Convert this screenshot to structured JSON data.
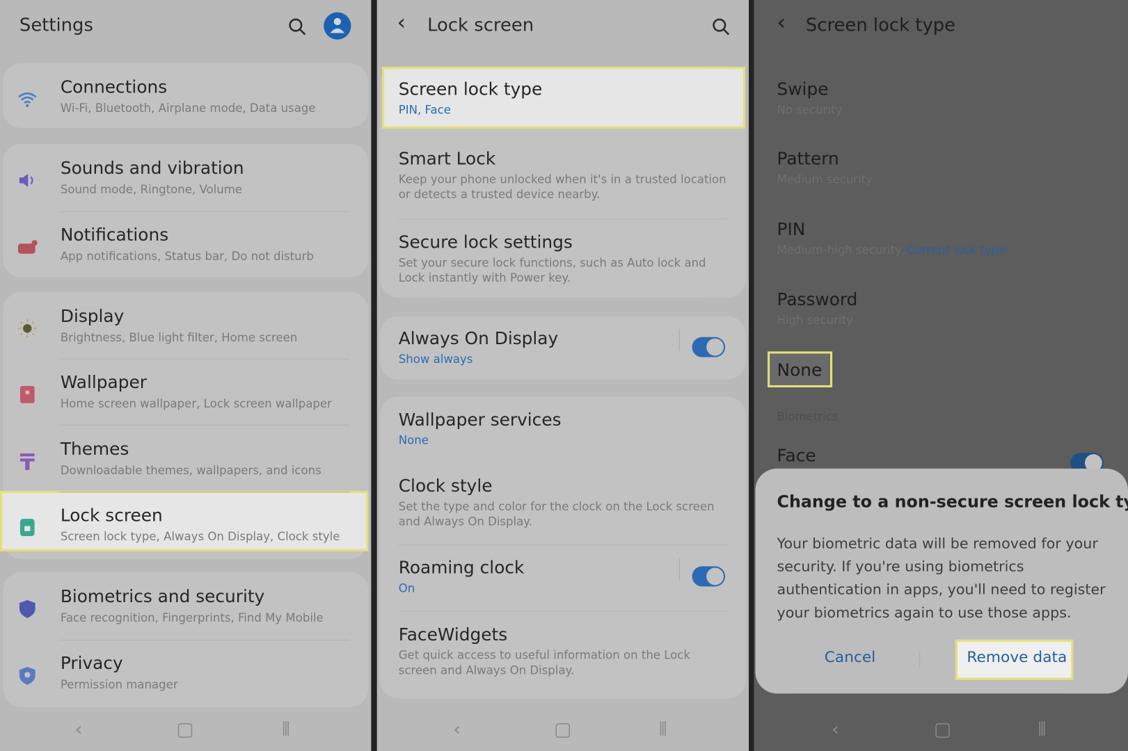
{
  "colors": {
    "accent": "#2c6bb3",
    "highlight": "#e3e07a"
  },
  "settings": {
    "title": "Settings",
    "items": [
      {
        "title": "Connections",
        "subtitle": "Wi-Fi, Bluetooth, Airplane mode, Data usage",
        "icon": "wifi-icon"
      },
      {
        "title": "Sounds and vibration",
        "subtitle": "Sound mode, Ringtone, Volume",
        "icon": "speaker-icon"
      },
      {
        "title": "Notifications",
        "subtitle": "App notifications, Status bar, Do not disturb",
        "icon": "notification-icon"
      },
      {
        "title": "Display",
        "subtitle": "Brightness, Blue light filter, Home screen",
        "icon": "sun-icon"
      },
      {
        "title": "Wallpaper",
        "subtitle": "Home screen wallpaper, Lock screen wallpaper",
        "icon": "wallpaper-icon"
      },
      {
        "title": "Themes",
        "subtitle": "Downloadable themes, wallpapers, and icons",
        "icon": "brush-icon"
      },
      {
        "title": "Lock screen",
        "subtitle": "Screen lock type, Always On Display, Clock style",
        "icon": "lock-icon",
        "highlighted": true
      },
      {
        "title": "Biometrics and security",
        "subtitle": "Face recognition, Fingerprints, Find My Mobile",
        "icon": "shield-icon"
      },
      {
        "title": "Privacy",
        "subtitle": "Permission manager",
        "icon": "privacy-shield-icon"
      }
    ]
  },
  "lockscreen": {
    "title": "Lock screen",
    "items": [
      {
        "title": "Screen lock type",
        "subtitle": "PIN, Face",
        "subtitle_blue": true,
        "highlighted": true
      },
      {
        "title": "Smart Lock",
        "subtitle": "Keep your phone unlocked when it's in a trusted location\nor detects a trusted device nearby."
      },
      {
        "title": "Secure lock settings",
        "subtitle": "Set your secure lock functions, such as Auto lock and\nLock instantly with Power key."
      },
      {
        "title": "Always On Display",
        "subtitle": "Show always",
        "subtitle_blue": true,
        "toggle": true
      },
      {
        "title": "Wallpaper services",
        "subtitle": "None",
        "subtitle_blue": true
      },
      {
        "title": "Clock style",
        "subtitle": "Set the type and color for the clock on the Lock screen\nand Always On Display."
      },
      {
        "title": "Roaming clock",
        "subtitle": "On",
        "subtitle_blue": true,
        "toggle": true
      },
      {
        "title": "FaceWidgets",
        "subtitle": "Get quick access to useful information on the Lock\nscreen and Always On Display."
      }
    ]
  },
  "locktype": {
    "title": "Screen lock type",
    "items": [
      {
        "title": "Swipe",
        "subtitle": "No security"
      },
      {
        "title": "Pattern",
        "subtitle": "Medium security"
      },
      {
        "title": "PIN",
        "subtitle": "Medium-high security,",
        "current": "Current lock type"
      },
      {
        "title": "Password",
        "subtitle": "High security"
      }
    ],
    "none": "None",
    "biometrics_header": "Biometrics",
    "face": "Face",
    "dialog": {
      "title": "Change to a non-secure screen lock type?",
      "body": "Your biometric data will be removed for your\nsecurity. If you're using biometrics\nauthentication in apps, you'll need to register\nyour biometrics again to use those apps.",
      "cancel": "Cancel",
      "confirm": "Remove data"
    }
  }
}
